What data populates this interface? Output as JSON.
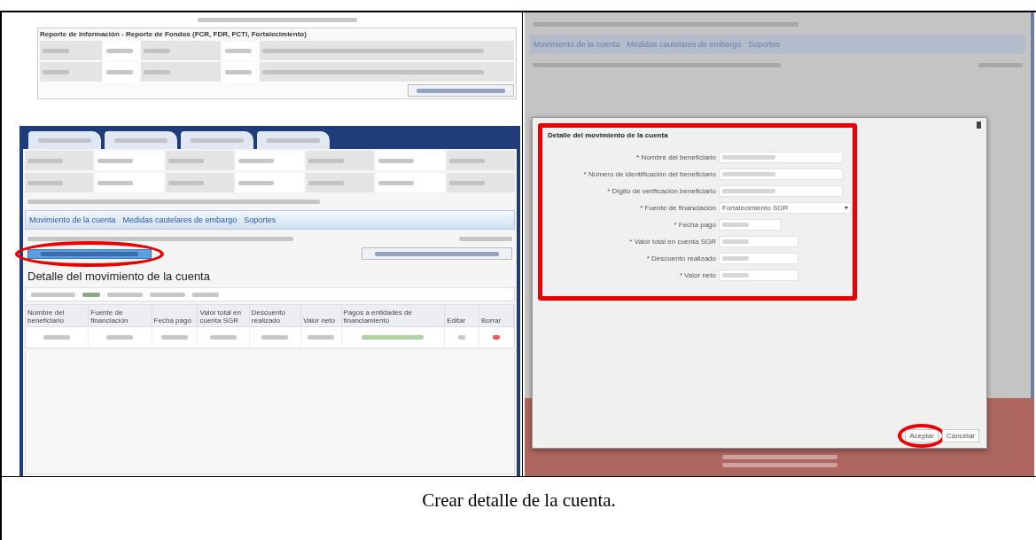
{
  "left_screenshot": {
    "report_title": "Reporte de Información - Reporte de Fondos (FCR, FDR, FCTI, Fortalecimiento)",
    "section_tabs": [
      "Movimiento de la cuenta",
      "Medidas cautelares de embargo",
      "Soportes"
    ],
    "detail_title": "Detalle del movimiento de la cuenta",
    "table_columns": [
      "Nombre del beneficiario",
      "Fuente de financiación",
      "Fecha pago",
      "Valor total en cuenta SGR",
      "Descuento realizado",
      "Valor neto",
      "Pagos a entidades de financiamiento",
      "Editar",
      "Borrar"
    ]
  },
  "right_screenshot": {
    "background_tabs": [
      "Movimiento de la cuenta",
      "Medidas cautelares de embargo",
      "Soportes"
    ],
    "dialog": {
      "title": "Detalle del movimiento de la cuenta",
      "fields": [
        {
          "label": "* Nombre del beneficiario",
          "kind": "text"
        },
        {
          "label": "* Número de identificación del beneficiario",
          "kind": "text"
        },
        {
          "label": "* Dígito de verificación beneficiario",
          "kind": "text"
        },
        {
          "label": "* Fuente de financiación",
          "kind": "select",
          "value": "Fortalecimiento SGR"
        },
        {
          "label": "* Fecha pago",
          "kind": "date"
        },
        {
          "label": "* Valor total en cuenta SGR",
          "kind": "number"
        },
        {
          "label": "* Descuento realizado",
          "kind": "number"
        },
        {
          "label": "* Valor neto",
          "kind": "number"
        }
      ],
      "buttons": [
        "Aceptar",
        "Cancelar"
      ]
    }
  },
  "caption": "Crear detalle de la cuenta."
}
